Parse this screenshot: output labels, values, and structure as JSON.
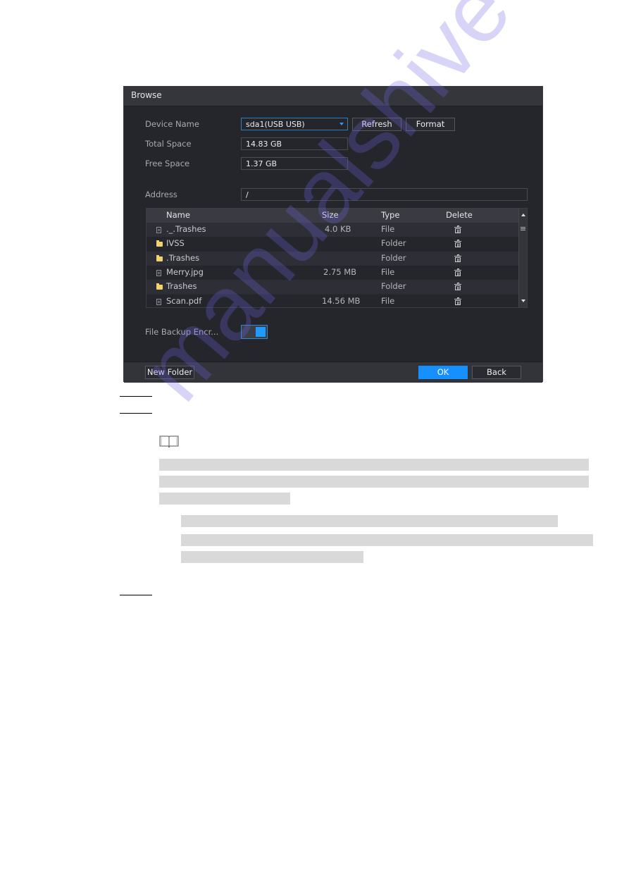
{
  "dialog": {
    "title": "Browse",
    "device_name_label": "Device Name",
    "device_name_value": "sda1(USB USB)",
    "refresh_label": "Refresh",
    "format_label": "Format",
    "total_space_label": "Total Space",
    "total_space_value": "14.83 GB",
    "free_space_label": "Free Space",
    "free_space_value": "1.37 GB",
    "address_label": "Address",
    "address_value": "/",
    "table": {
      "columns": [
        "Name",
        "Size",
        "Type",
        "Delete"
      ],
      "rows": [
        {
          "icon": "file-icon",
          "name": "._.Trashes",
          "size": "4.0 KB",
          "type": "File"
        },
        {
          "icon": "folder-icon",
          "name": "IVSS",
          "size": "",
          "type": "Folder"
        },
        {
          "icon": "folder-icon",
          "name": ".Trashes",
          "size": "",
          "type": "Folder"
        },
        {
          "icon": "file-icon",
          "name": "Merry.jpg",
          "size": "2.75 MB",
          "type": "File"
        },
        {
          "icon": "folder-icon",
          "name": "Trashes",
          "size": "",
          "type": "Folder"
        },
        {
          "icon": "file-icon",
          "name": "Scan.pdf",
          "size": "14.56 MB",
          "type": "File"
        }
      ]
    },
    "encryption_label": "File Backup Encr...",
    "encryption_enabled": true,
    "new_folder_label": "New Folder",
    "ok_label": "OK",
    "back_label": "Back"
  },
  "document": {
    "watermark": "manualshive"
  }
}
